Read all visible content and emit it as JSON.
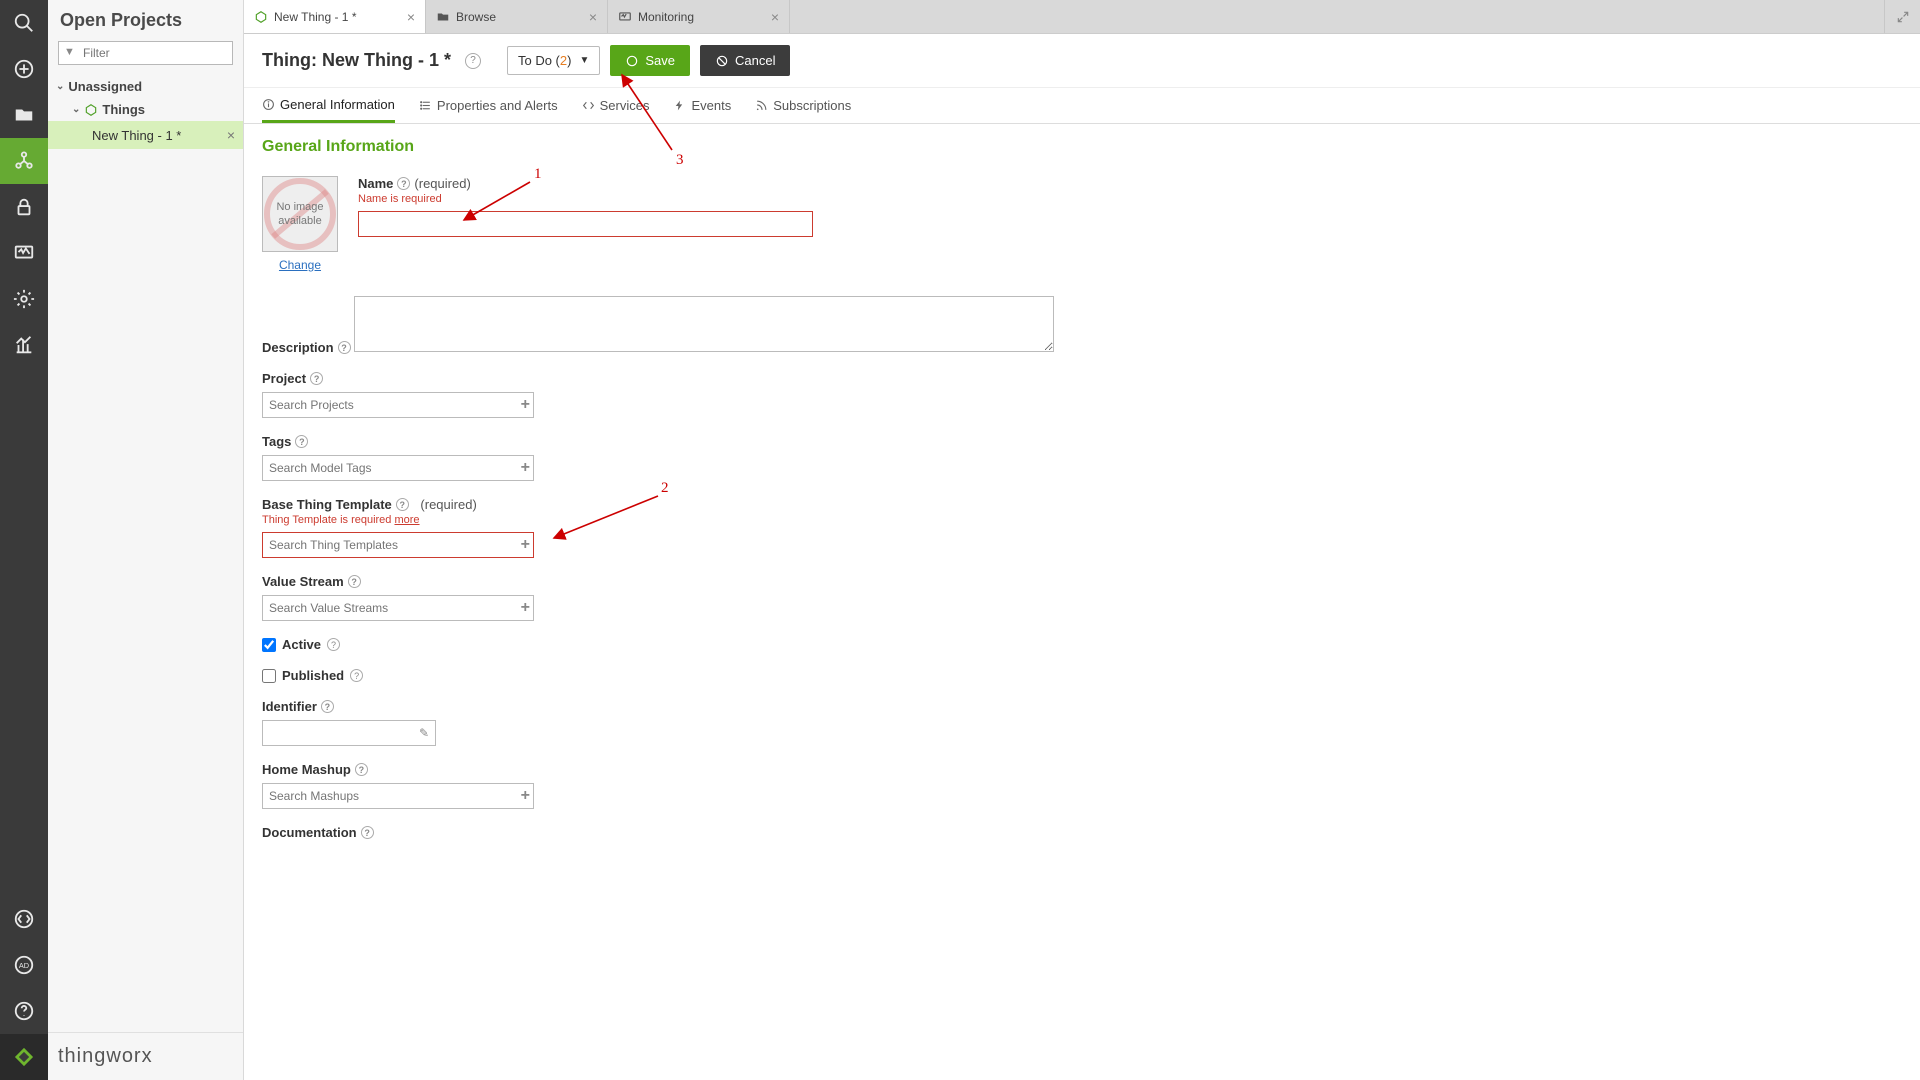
{
  "sidebar": {
    "title": "Open Projects",
    "filter_placeholder": "Filter",
    "tree": {
      "group": "Unassigned",
      "sub": "Things",
      "leaf": "New Thing - 1 *"
    },
    "footer_brand": "thingworx"
  },
  "tabs": [
    {
      "label": "New Thing - 1 *",
      "icon": "hexagon",
      "active": true
    },
    {
      "label": "Browse",
      "icon": "folder",
      "active": false
    },
    {
      "label": "Monitoring",
      "icon": "monitor",
      "active": false
    }
  ],
  "header": {
    "title": "Thing: New Thing - 1 *",
    "todo_label": "To Do (",
    "todo_count": "2",
    "todo_close": ")",
    "save": "Save",
    "cancel": "Cancel"
  },
  "subtabs": [
    {
      "label": "General Information",
      "active": true
    },
    {
      "label": "Properties and Alerts",
      "active": false
    },
    {
      "label": "Services",
      "active": false
    },
    {
      "label": "Events",
      "active": false
    },
    {
      "label": "Subscriptions",
      "active": false
    }
  ],
  "section_title": "General Information",
  "avatar": {
    "placeholder": "No image available",
    "change": "Change"
  },
  "fields": {
    "name": {
      "label": "Name",
      "req": "(required)",
      "err": "Name is required"
    },
    "description": {
      "label": "Description"
    },
    "project": {
      "label": "Project",
      "placeholder": "Search Projects"
    },
    "tags": {
      "label": "Tags",
      "placeholder": "Search Model Tags"
    },
    "base_template": {
      "label": "Base Thing Template",
      "req": "(required)",
      "err": "Thing Template is required ",
      "more": "more",
      "placeholder": "Search Thing Templates"
    },
    "value_stream": {
      "label": "Value Stream",
      "placeholder": "Search Value Streams"
    },
    "active": {
      "label": "Active",
      "checked": true
    },
    "published": {
      "label": "Published",
      "checked": false
    },
    "identifier": {
      "label": "Identifier"
    },
    "home_mashup": {
      "label": "Home Mashup",
      "placeholder": "Search Mashups"
    },
    "documentation": {
      "label": "Documentation"
    }
  },
  "annotations": {
    "n1": "1",
    "n2": "2",
    "n3": "3"
  }
}
